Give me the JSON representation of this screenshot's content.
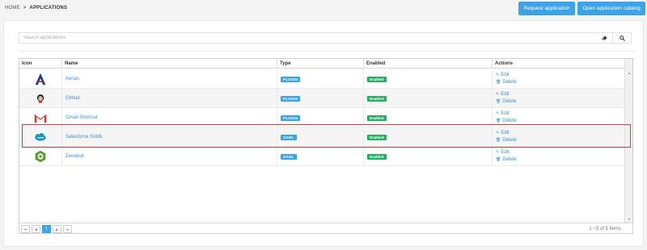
{
  "breadcrumb": {
    "home": "HOME",
    "separator": ">",
    "current": "APPLICATIONS"
  },
  "buttons": {
    "request": "Request application",
    "catalog": "Open application catalog"
  },
  "search": {
    "placeholder": "Search applications"
  },
  "columns": {
    "icon": "Icon",
    "name": "Name",
    "type": "Type",
    "enabled": "Enabled",
    "actions": "Actions"
  },
  "rows": [
    {
      "name": "Aerias",
      "icon": "aerias-logo-icon",
      "type": "PLUGIN",
      "enabled": "Enabled",
      "edit": "Edit",
      "delete": "Delete"
    },
    {
      "name": "Github",
      "icon": "github-logo-icon",
      "type": "PLUGIN",
      "enabled": "Enabled",
      "edit": "Edit",
      "delete": "Delete"
    },
    {
      "name": "Gmail Shortcut",
      "icon": "gmail-logo-icon",
      "type": "PLUGIN",
      "enabled": "Enabled",
      "edit": "Edit",
      "delete": "Delete"
    },
    {
      "name": "Salesforce SAML",
      "icon": "salesforce-logo-icon",
      "type": "SAML",
      "enabled": "Enabled",
      "edit": "Edit",
      "delete": "Delete"
    },
    {
      "name": "Zendesk",
      "icon": "zendesk-logo-icon",
      "type": "SAML",
      "enabled": "Enabled",
      "edit": "Edit",
      "delete": "Delete"
    }
  ],
  "pager": {
    "current_page": "1",
    "info": "1 - 5 of 5 items"
  },
  "colors": {
    "accent": "#3ba3e8",
    "enabled": "#22b05e",
    "highlight": "#d23b3b",
    "link": "#3b8fd6"
  }
}
